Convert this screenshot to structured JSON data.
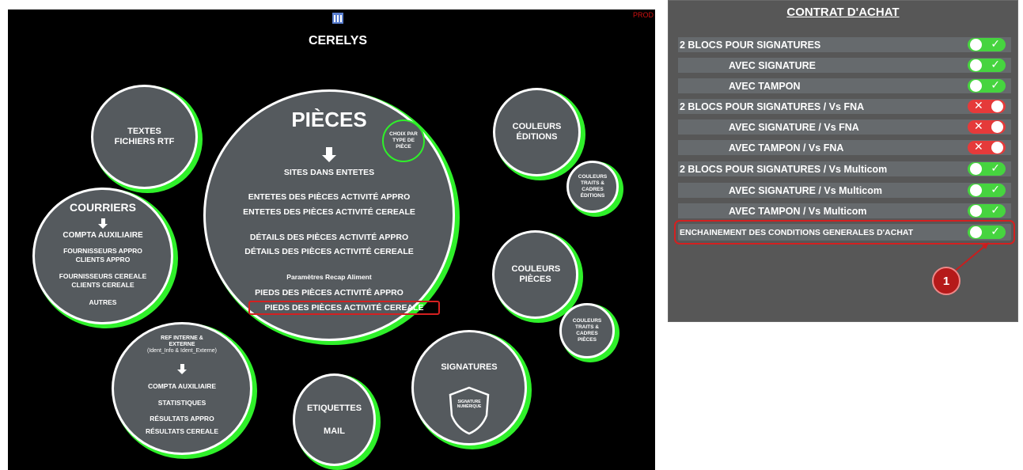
{
  "main": {
    "corner_text": "PROD",
    "app_title": "CERELYS",
    "pieces": {
      "title": "PIÈCES",
      "sub_bubble": "CHOIX PAR TYPE DE PIÈCE",
      "items": [
        "SITES DANS ENTETES",
        "ENTETES DES PIÈCES ACTIVITÉ APPRO",
        "ENTETES DES PIÈCES ACTIVITÉ CEREALE",
        "DÉTAILS DES PIÈCES ACTIVITÉ APPRO",
        "DÉTAILS DES PIÈCES ACTIVITÉ CEREALE",
        "Paramètres Recap Aliment",
        "PIEDS DES PIÈCES ACTIVITÉ APPRO",
        "PIEDS DES PIÈCES ACTIVITÉ CEREALE"
      ]
    },
    "textes": "TEXTES FICHIERS RTF",
    "courriers": {
      "title": "COURRIERS",
      "items": [
        "COMPTA AUXILIAIRE",
        "FOURNISSEURS APPRO",
        "CLIENTS APPRO",
        "FOURNISSEURS CEREALE",
        "CLIENTS CEREALE",
        "AUTRES"
      ]
    },
    "ref": {
      "title": "REF INTERNE & EXTERNE",
      "subtitle": "(Ident_Info & Ident_Externe)",
      "items": [
        "COMPTA AUXILIAIRE",
        "STATISTIQUES",
        "RÉSULTATS APPRO",
        "RÉSULTATS CEREALE"
      ]
    },
    "etiquettes": "ETIQUETTES",
    "mail": "MAIL",
    "signatures": "SIGNATURES",
    "signature_numerique": "SIGNATURE NUMÉRIQUE",
    "couleurs_editions": "COULEURS ÉDITIONS",
    "couleurs_traits_editions": "COULEURS TRAITS & CADRES ÉDITIONS",
    "couleurs_pieces": "COULEURS PIÈCES",
    "couleurs_traits_pieces": "COULEURS TRAITS & CADRES PIÈCES"
  },
  "contract": {
    "title": "CONTRAT D'ACHAT",
    "rows": [
      {
        "label": "2 BLOCS POUR SIGNATURES",
        "state": "on",
        "indent": false
      },
      {
        "label": "AVEC SIGNATURE",
        "state": "on",
        "indent": true
      },
      {
        "label": "AVEC TAMPON",
        "state": "on",
        "indent": true
      },
      {
        "label": "2 BLOCS POUR SIGNATURES / Vs FNA",
        "state": "off",
        "indent": false
      },
      {
        "label": "AVEC SIGNATURE / Vs FNA",
        "state": "off",
        "indent": true
      },
      {
        "label": "AVEC TAMPON / Vs FNA",
        "state": "off",
        "indent": true
      },
      {
        "label": "2 BLOCS POUR SIGNATURES / Vs Multicom",
        "state": "on",
        "indent": false
      },
      {
        "label": "AVEC SIGNATURE / Vs Multicom",
        "state": "on",
        "indent": true
      },
      {
        "label": "AVEC TAMPON / Vs Multicom",
        "state": "on",
        "indent": true
      },
      {
        "label": "ENCHAINEMENT DES CONDITIONS GENERALES D'ACHAT",
        "state": "on",
        "indent": false
      }
    ],
    "callout": "1"
  },
  "colors": {
    "accent_green": "#2ff02a",
    "highlight_red": "#d42020",
    "toggle_on": "#46d43f",
    "toggle_off": "#e53a3a"
  }
}
